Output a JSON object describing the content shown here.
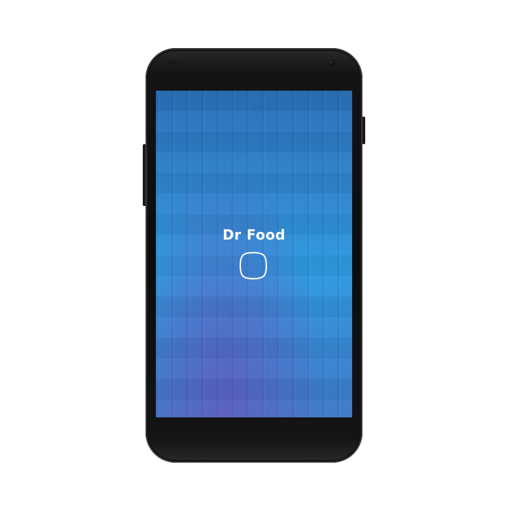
{
  "app": {
    "title": "Dr Food",
    "logo_icon": "rounded-square-icon"
  },
  "colors": {
    "screen_top": "#2a6fb8",
    "screen_mid": "#2e9ae0",
    "screen_bottom_accent": "#5a5fc0",
    "text": "#ffffff",
    "device_body": "#0c0c0c"
  }
}
